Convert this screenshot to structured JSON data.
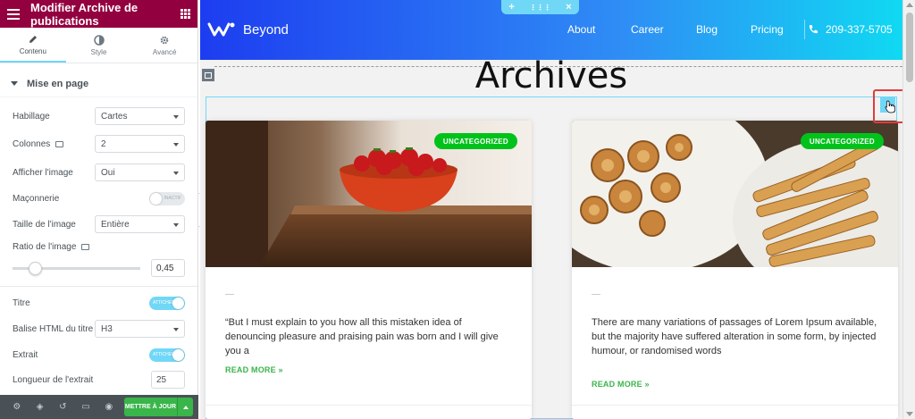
{
  "panel": {
    "title": "Modifier Archive de publications",
    "tabs": [
      {
        "label": "Contenu",
        "icon": "pencil-icon",
        "active": true
      },
      {
        "label": "Style",
        "icon": "contrast-icon",
        "active": false
      },
      {
        "label": "Avancé",
        "icon": "gear-icon",
        "active": false
      }
    ],
    "section": "Mise en page",
    "controls": {
      "habillage": {
        "label": "Habillage",
        "value": "Cartes"
      },
      "colonnes": {
        "label": "Colonnes",
        "value": "2"
      },
      "afficher_image": {
        "label": "Afficher l'image",
        "value": "Oui"
      },
      "maconnerie": {
        "label": "Maçonnerie",
        "state": "INACTIF"
      },
      "taille_image": {
        "label": "Taille de l'image",
        "value": "Entière"
      },
      "ratio_image": {
        "label": "Ratio de l'image",
        "value": "0,45"
      },
      "titre": {
        "label": "Titre",
        "state": "ATTICHER"
      },
      "balise_titre": {
        "label": "Balise HTML du titre",
        "value": "H3"
      },
      "extrait": {
        "label": "Extrait",
        "state": "ATTICHER"
      },
      "longueur_extrait": {
        "label": "Longueur de l'extrait",
        "value": "25"
      }
    },
    "footer": {
      "update_label": "METTRE À JOUR",
      "icons": [
        "gear-icon",
        "layers-icon",
        "history-icon",
        "responsive-icon",
        "eye-icon"
      ]
    }
  },
  "site": {
    "logo_text": "Beyond",
    "nav": [
      "About",
      "Career",
      "Blog",
      "Pricing"
    ],
    "phone": "209-337-5705",
    "edit_handle": [
      "+",
      "⋮⋮⋮",
      "×"
    ],
    "page_title": "Archives"
  },
  "cards": [
    {
      "badge": "UNCATEGORIZED",
      "dash": "—",
      "text": "“But I must explain to you how all this mistaken idea of denouncing pleasure and praising pain was born and I will give you a",
      "read_more": "READ MORE »",
      "image": "strawberries-bowl"
    },
    {
      "badge": "UNCATEGORIZED",
      "dash": "—",
      "text": "There are many variations of passages of Lorem Ipsum available, but the majority have suffered alteration in some form, by injected humour, or randomised words",
      "read_more": "READ MORE »",
      "image": "pastries-plate"
    }
  ],
  "colors": {
    "panel_header": "#93003f",
    "accent": "#71d7f7",
    "green": "#39b54a",
    "badge_green": "#00c21b"
  }
}
